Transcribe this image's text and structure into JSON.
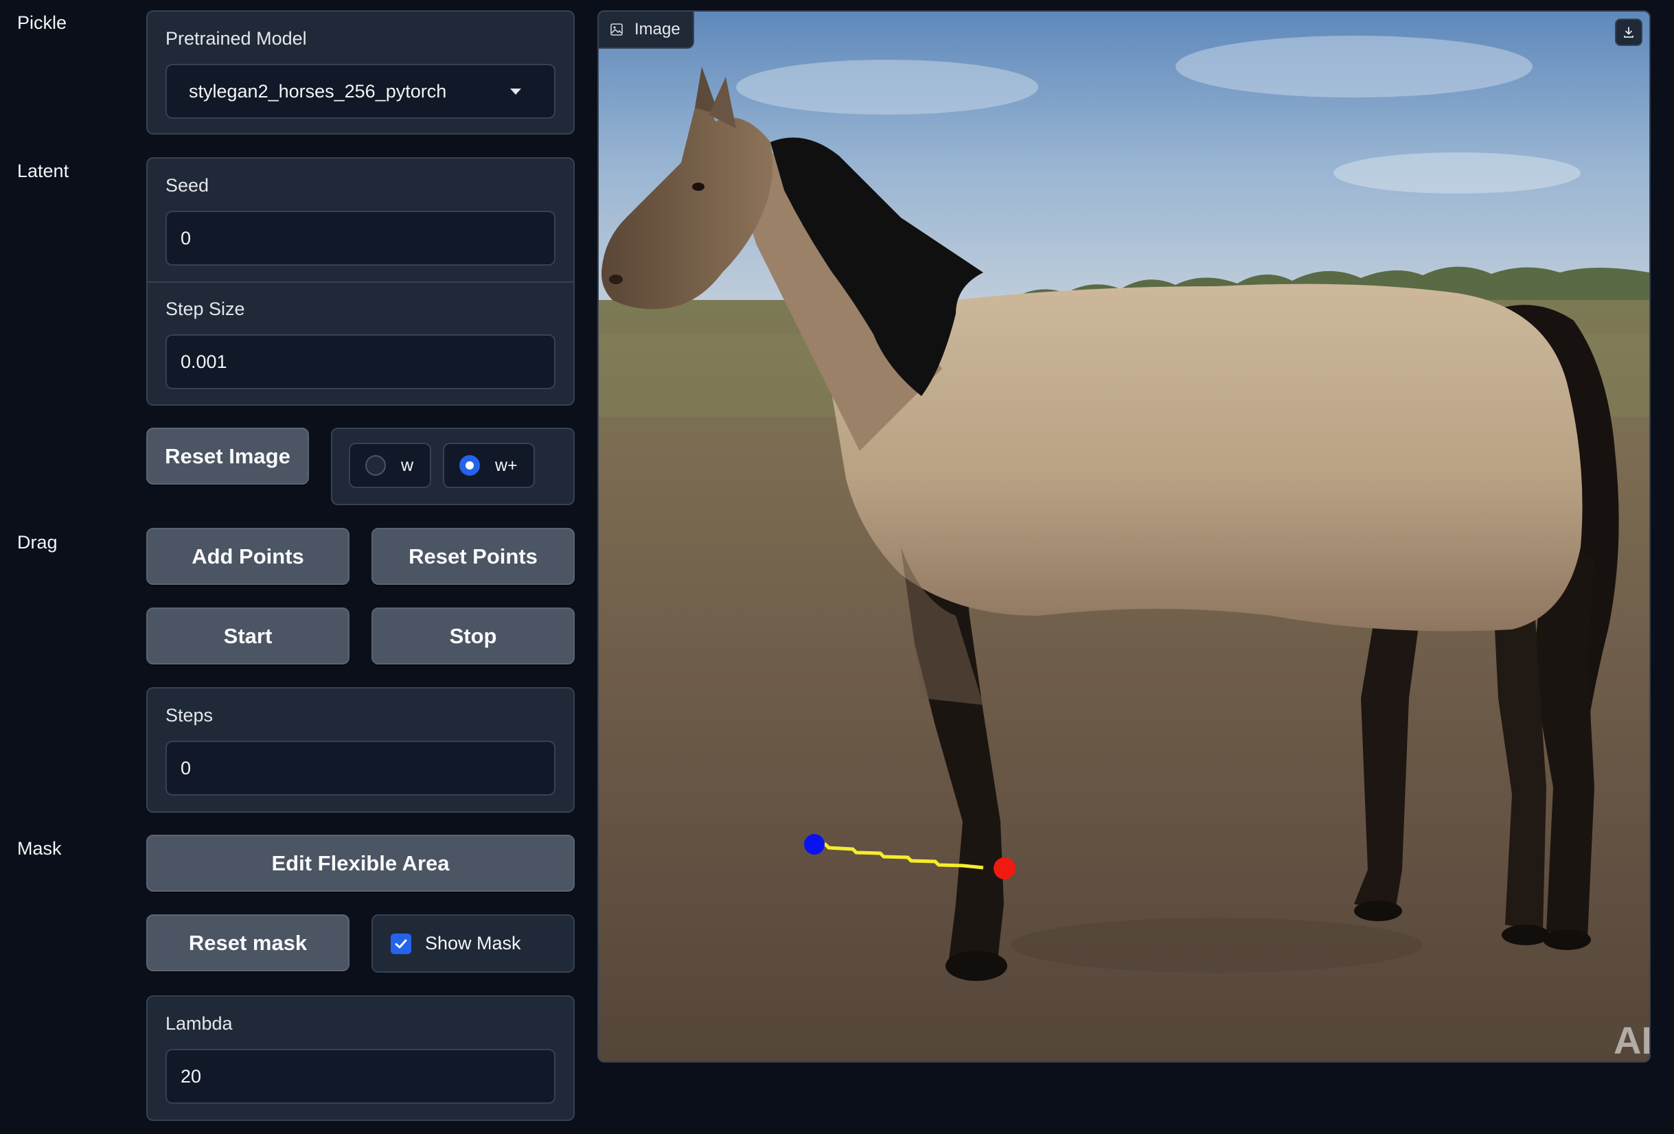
{
  "sections": {
    "pickle": "Pickle",
    "latent": "Latent",
    "drag": "Drag",
    "mask": "Mask"
  },
  "pretrained": {
    "label": "Pretrained Model",
    "value": "stylegan2_horses_256_pytorch"
  },
  "seed": {
    "label": "Seed",
    "value": "0"
  },
  "step_size": {
    "label": "Step Size",
    "value": "0.001"
  },
  "reset_image_label": "Reset Image",
  "latent_space": {
    "options": [
      "w",
      "w+"
    ],
    "selected": "w+"
  },
  "drag_buttons": {
    "add_points": "Add Points",
    "reset_points": "Reset Points",
    "start": "Start",
    "stop": "Stop"
  },
  "steps": {
    "label": "Steps",
    "value": "0"
  },
  "edit_flexible_area_label": "Edit Flexible Area",
  "reset_mask_label": "Reset mask",
  "show_mask": {
    "label": "Show Mask",
    "checked": true
  },
  "lambda": {
    "label": "Lambda",
    "value": "20"
  },
  "image_panel": {
    "tab_label": "Image",
    "watermark": "AI"
  },
  "colors": {
    "accent": "#2563eb",
    "handle_point": "#0a12f0",
    "target_point": "#f01a10",
    "drag_path": "#f4ee2a"
  }
}
